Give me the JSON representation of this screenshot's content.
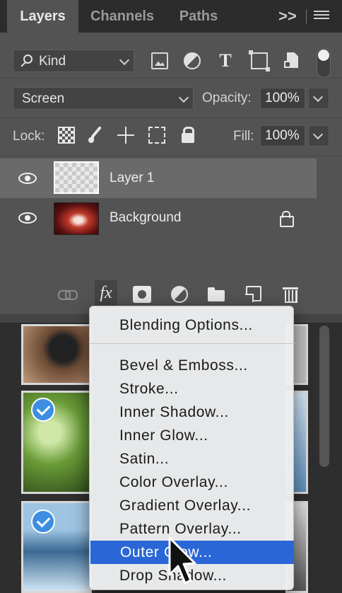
{
  "tabs": {
    "items": [
      {
        "label": "Layers",
        "active": true
      },
      {
        "label": "Channels",
        "active": false
      },
      {
        "label": "Paths",
        "active": false
      }
    ],
    "overflow": ">>"
  },
  "filter": {
    "kind_label": "Kind",
    "icons": [
      "image-filter-icon",
      "adjustment-filter-icon",
      "type-filter-icon",
      "shape-filter-icon",
      "smart-object-filter-icon"
    ]
  },
  "blending": {
    "mode": "Screen",
    "opacity_label": "Opacity:",
    "opacity_value": "100%"
  },
  "lock": {
    "label": "Lock:",
    "fill_label": "Fill:",
    "fill_value": "100%"
  },
  "layers": [
    {
      "name": "Layer 1",
      "selected": true,
      "visible": true,
      "locked": false
    },
    {
      "name": "Background",
      "selected": false,
      "visible": true,
      "locked": true
    }
  ],
  "toolbar": {
    "fx_label": "fx"
  },
  "menu": {
    "items": [
      "Blending Options...",
      "Bevel & Emboss...",
      "Stroke...",
      "Inner Shadow...",
      "Inner Glow...",
      "Satin...",
      "Color Overlay...",
      "Gradient Overlay...",
      "Pattern Overlay...",
      "Outer Glow...",
      "Drop Shadow..."
    ],
    "highlighted": "Outer Glow..."
  },
  "colors": {
    "panel_bg": "#535353",
    "tab_bg": "#2c2c2c",
    "menu_bg": "#eceef0",
    "menu_highlight": "#2a66d6",
    "check_blue": "#3d8ee0"
  }
}
